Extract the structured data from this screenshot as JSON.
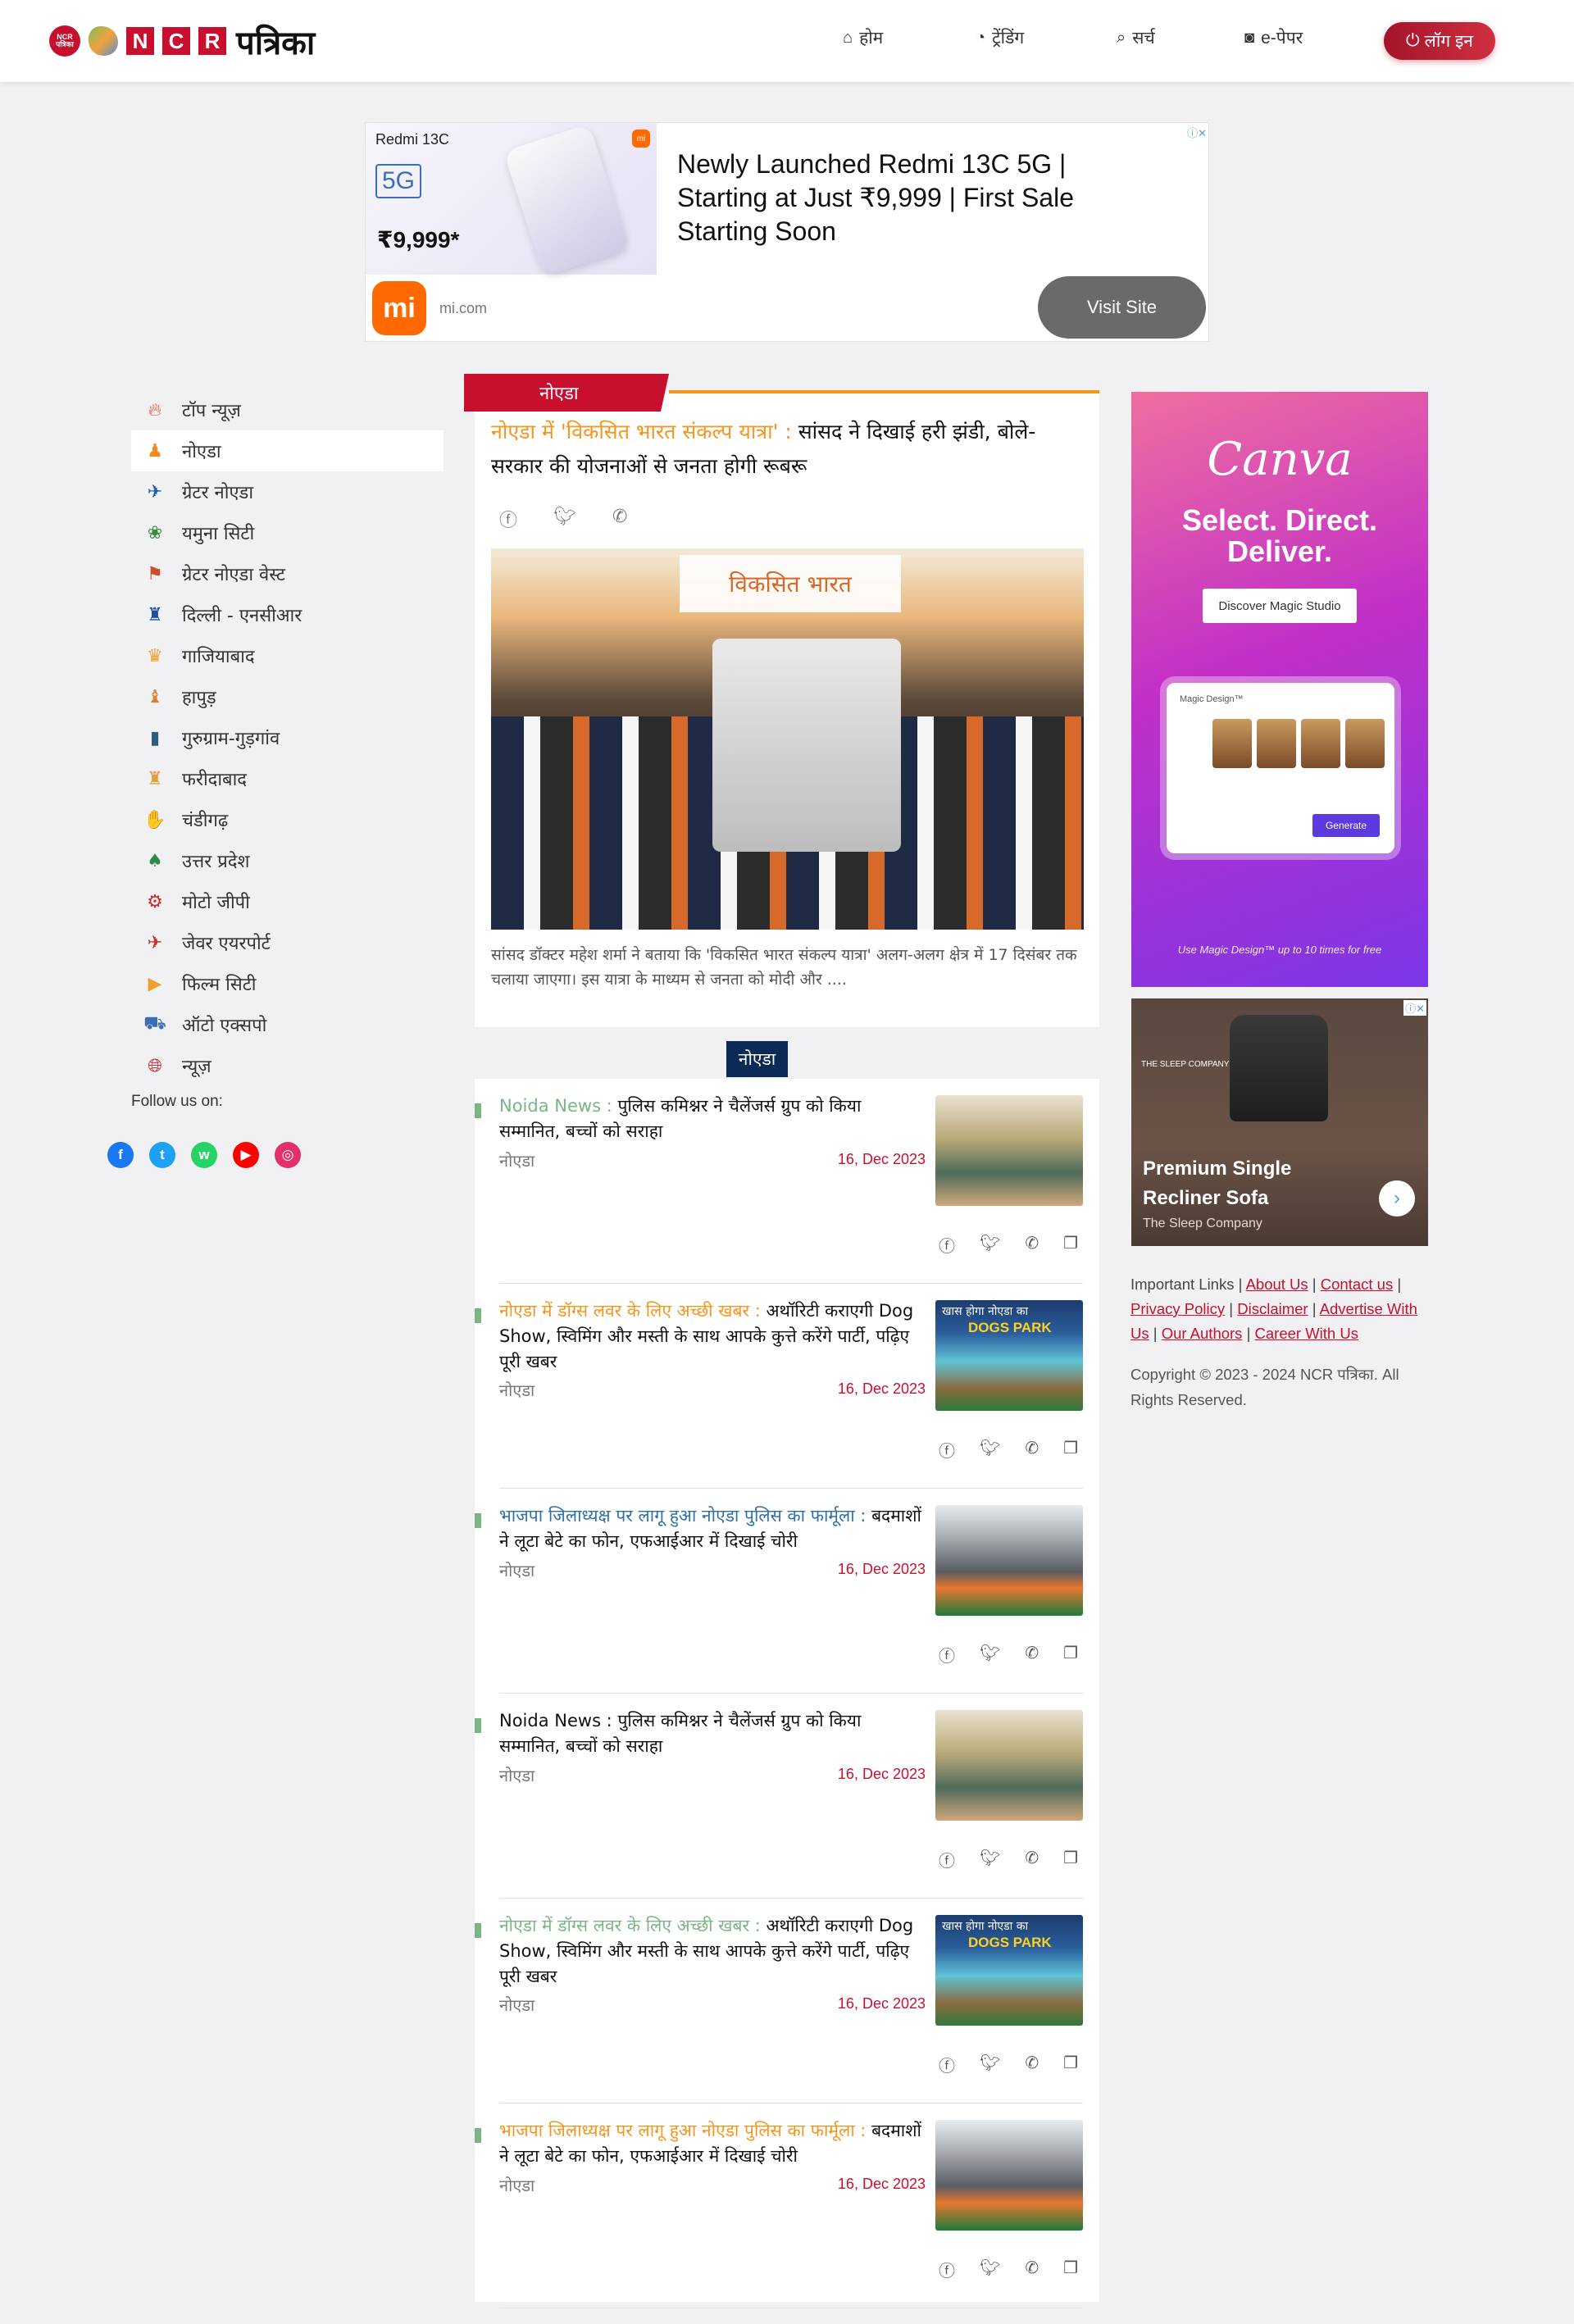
{
  "header": {
    "logo_badge": "NCR पत्रिका",
    "logo_letters": [
      "N",
      "C",
      "R"
    ],
    "logo_text": "पत्रिका",
    "nav": [
      {
        "icon": "home-icon",
        "label": "होम"
      },
      {
        "icon": "trending-icon",
        "label": "ट्रेंडिंग"
      },
      {
        "icon": "search-icon",
        "label": "सर्च"
      },
      {
        "icon": "epaper-icon",
        "label": "e-पेपर"
      }
    ],
    "login_label": "लॉग इन"
  },
  "top_ad": {
    "brand": "Redmi 13C",
    "network": "5G",
    "price": "₹9,999*",
    "headline": "Newly Launched Redmi 13C 5G | Starting at Just ₹9,999 | First Sale Starting Soon",
    "domain": "mi.com",
    "cta": "Visit Site",
    "logo": "mi"
  },
  "sidebar": {
    "items": [
      {
        "label": "टॉप न्यूज़",
        "icon": "fire-icon",
        "active": false
      },
      {
        "label": "नोएडा",
        "icon": "noida-icon",
        "active": true
      },
      {
        "label": "ग्रेटर नोएडा",
        "icon": "greater-noida-icon",
        "active": false
      },
      {
        "label": "यमुना सिटी",
        "icon": "yamuna-city-icon",
        "active": false
      },
      {
        "label": "ग्रेटर नोएडा वेस्ट",
        "icon": "greater-noida-west-icon",
        "active": false
      },
      {
        "label": "दिल्ली - एनसीआर",
        "icon": "delhi-ncr-icon",
        "active": false
      },
      {
        "label": "गाजियाबाद",
        "icon": "ghaziabad-icon",
        "active": false
      },
      {
        "label": "हापुड़",
        "icon": "hapur-icon",
        "active": false
      },
      {
        "label": "गुरुग्राम-गुड़गांव",
        "icon": "gurugram-icon",
        "active": false
      },
      {
        "label": "फरीदाबाद",
        "icon": "faridabad-icon",
        "active": false
      },
      {
        "label": "चंडीगढ़",
        "icon": "chandigarh-icon",
        "active": false
      },
      {
        "label": "उत्तर प्रदेश",
        "icon": "uttar-pradesh-icon",
        "active": false
      },
      {
        "label": "मोटो जीपी",
        "icon": "moto-gp-icon",
        "active": false
      },
      {
        "label": "जेवर एयरपोर्ट",
        "icon": "airport-icon",
        "active": false
      },
      {
        "label": "फिल्म सिटी",
        "icon": "film-city-icon",
        "active": false
      },
      {
        "label": "ऑटो एक्सपो",
        "icon": "auto-expo-icon",
        "active": false
      },
      {
        "label": "न्यूज़",
        "icon": "globe-icon",
        "active": false
      }
    ],
    "follow_label": "Follow us on:",
    "social": [
      {
        "name": "facebook-icon",
        "color": "#1877f2",
        "glyph": "f"
      },
      {
        "name": "twitter-icon",
        "color": "#1da1f2",
        "glyph": "t"
      },
      {
        "name": "whatsapp-icon",
        "color": "#25d366",
        "glyph": "w"
      },
      {
        "name": "youtube-icon",
        "color": "#ff0000",
        "glyph": "▶"
      },
      {
        "name": "instagram-icon",
        "color": "#e1306c",
        "glyph": "◎"
      }
    ]
  },
  "lead": {
    "category": "नोएडा",
    "title_highlight": "नोएडा में 'विकसित भारत संकल्प यात्रा' : ",
    "title_rest": "सांसद ने दिखाई हरी झंडी, बोले-सरकार की योजनाओं से जनता होगी रूबरू",
    "image_banner": "विकसित भारत",
    "description": "सांसद डॉक्टर महेश शर्मा ने बताया कि 'विकसित भारत संकल्प यात्रा' अलग-अलग क्षेत्र में 17 दिसंबर तक चलाया जाएगा। इस यात्रा के माध्यम से जनता को मोदी और ...."
  },
  "list_category": "नोएडा",
  "news": [
    {
      "prefix": "Noida News : ",
      "prefix_color": "#7bb585",
      "title": "पुलिस कमिश्नर ने चैलेंजर्स ग्रुप को किया सम्मानित, बच्चों को सराहा",
      "category": "नोएडा",
      "date": "16, Dec 2023",
      "thumb": "award",
      "lines": 2
    },
    {
      "prefix": "नोएडा में डॉग्स लवर के लिए अच्छी खबर : ",
      "prefix_color": "#f7941d",
      "title": "अथॉरिटी कराएगी Dog Show, स्विमिंग और मस्ती के साथ आपके कुत्ते करेंगे पार्टी, पढ़िए पूरी खबर",
      "category": "नोएडा",
      "date": "16, Dec 2023",
      "thumb": "dog",
      "lines": 3
    },
    {
      "prefix": "भाजपा जिलाध्यक्ष पर लागू हुआ नोएडा पुलिस का फार्मूला : ",
      "prefix_color": "#2f6fa8",
      "title": "बदमाशों ने लूटा बेटे का फोन, एफआईआर में दिखाई चोरी",
      "category": "नोएडा",
      "date": "16, Dec 2023",
      "thumb": "bjp",
      "lines": 2
    },
    {
      "prefix": "Noida News : ",
      "prefix_color": "#111111",
      "title": "पुलिस कमिश्नर ने चैलेंजर्स ग्रुप को किया सम्मानित, बच्चों को सराहा",
      "category": "नोएडा",
      "date": "16, Dec 2023",
      "thumb": "award",
      "lines": 2
    },
    {
      "prefix": "नोएडा में डॉग्स लवर के लिए अच्छी खबर : ",
      "prefix_color": "#7bb585",
      "title": "अथॉरिटी कराएगी Dog Show, स्विमिंग और मस्ती के साथ आपके कुत्ते करेंगे पार्टी, पढ़िए पूरी खबर",
      "category": "नोएडा",
      "date": "16, Dec 2023",
      "thumb": "dog",
      "lines": 3
    },
    {
      "prefix": "भाजपा जिलाध्यक्ष पर लागू हुआ नोएडा पुलिस का फार्मूला : ",
      "prefix_color": "#f7941d",
      "title": "बदमाशों ने लूटा बेटे का फोन, एफआईआर में दिखाई चोरी",
      "category": "नोएडा",
      "date": "16, Dec 2023",
      "thumb": "bjp",
      "lines": 2
    }
  ],
  "dog_thumb": {
    "line1": "खास होगा नोएडा का",
    "line2": "DOGS PARK"
  },
  "share_icons": [
    "facebook-icon",
    "twitter-icon",
    "whatsapp-icon",
    "copy-icon"
  ],
  "canva_ad": {
    "logo": "Canva",
    "tagline": "Select. Direct. Deliver.",
    "button": "Discover Magic Studio",
    "mock_title": "Magic Design™",
    "generate": "Generate",
    "footer": "Use Magic Design™ up to 10 times for free"
  },
  "sofa_ad": {
    "brand": "THE SLEEP COMPANY",
    "title": "Premium Single Recliner Sofa",
    "company": "The Sleep Company"
  },
  "footer": {
    "links_label": "Important Links",
    "links": [
      "About Us",
      "Contact us",
      "Privacy Policy",
      "Disclaimer",
      "Advertise With Us",
      "Our Authors",
      "Career With Us"
    ],
    "copyright": "Copyright © 2023 - 2024 NCR पत्रिका. All Rights Reserved."
  }
}
